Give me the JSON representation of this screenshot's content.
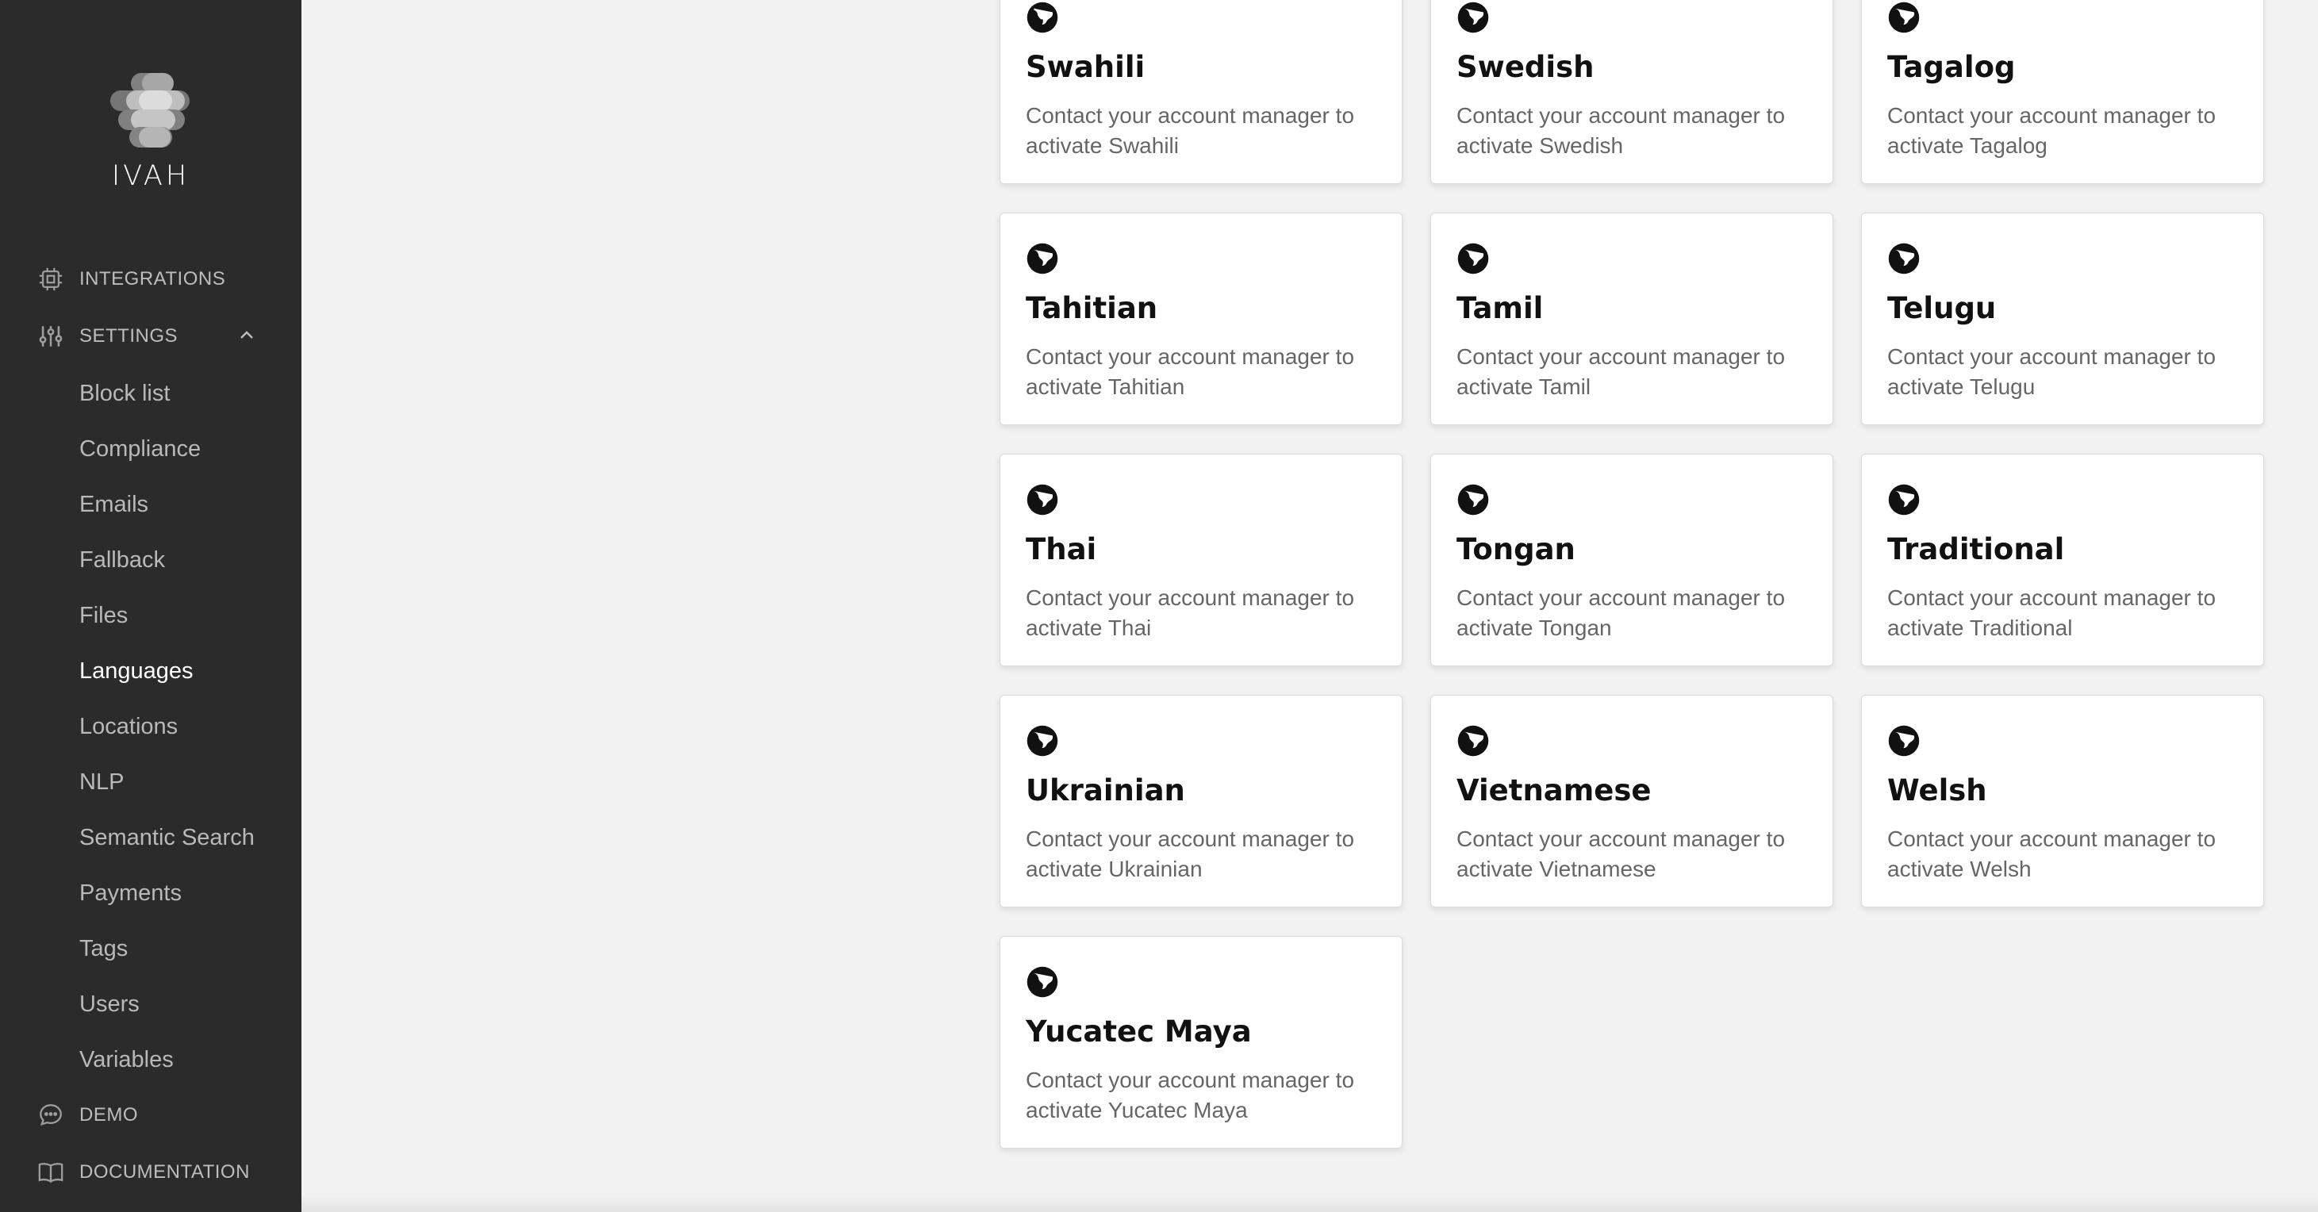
{
  "brand": {
    "name": "IVAH"
  },
  "sidebar": {
    "integrations_label": "INTEGRATIONS",
    "settings_label": "SETTINGS",
    "settings_items": [
      {
        "label": "Block list"
      },
      {
        "label": "Compliance"
      },
      {
        "label": "Emails"
      },
      {
        "label": "Fallback"
      },
      {
        "label": "Files"
      },
      {
        "label": "Languages",
        "active": true
      },
      {
        "label": "Locations"
      },
      {
        "label": "NLP"
      },
      {
        "label": "Semantic Search"
      },
      {
        "label": "Payments"
      },
      {
        "label": "Tags"
      },
      {
        "label": "Users"
      },
      {
        "label": "Variables"
      }
    ],
    "demo_label": "DEMO",
    "documentation_label": "DOCUMENTATION"
  },
  "languages": [
    {
      "name": "Swahili",
      "desc": "Contact your account manager to activate Swahili"
    },
    {
      "name": "Swedish",
      "desc": "Contact your account manager to activate Swedish"
    },
    {
      "name": "Tagalog",
      "desc": "Contact your account manager to activate Tagalog"
    },
    {
      "name": "Tahitian",
      "desc": "Contact your account manager to activate Tahitian"
    },
    {
      "name": "Tamil",
      "desc": "Contact your account manager to activate Tamil"
    },
    {
      "name": "Telugu",
      "desc": "Contact your account manager to activate Telugu"
    },
    {
      "name": "Thai",
      "desc": "Contact your account manager to activate Thai"
    },
    {
      "name": "Tongan",
      "desc": "Contact your account manager to activate Tongan"
    },
    {
      "name": "Traditional",
      "desc": "Contact your account manager to activate Traditional"
    },
    {
      "name": "Ukrainian",
      "desc": "Contact your account manager to activate Ukrainian"
    },
    {
      "name": "Vietnamese",
      "desc": "Contact your account manager to activate Vietnamese"
    },
    {
      "name": "Welsh",
      "desc": "Contact your account manager to activate Welsh"
    },
    {
      "name": "Yucatec Maya",
      "desc": "Contact your account manager to activate Yucatec Maya"
    }
  ],
  "icons": {
    "card_icon": "globe-icon",
    "integrations": "cpu-chip-icon",
    "settings": "sliders-icon",
    "demo": "chat-bubble-icon",
    "documentation": "book-icon",
    "collapse": "chevron-up-icon"
  },
  "colors": {
    "sidebar_bg": "#2b2b2b",
    "main_bg": "#f2f2f2",
    "card_bg": "#ffffff",
    "active_text": "#ffffff"
  }
}
